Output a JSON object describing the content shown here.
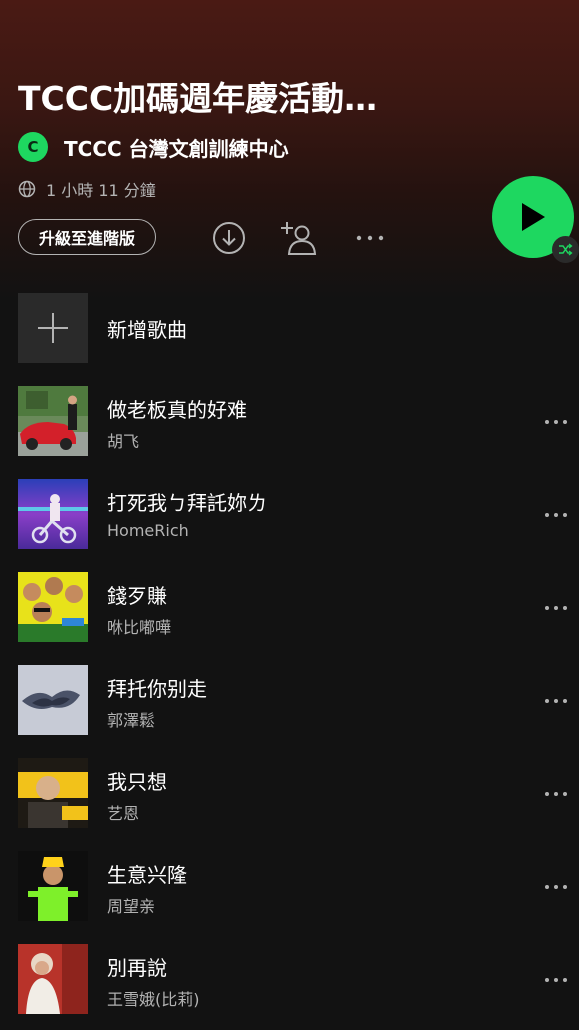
{
  "playlist": {
    "title": "TCCC加碼週年慶活動…",
    "owner_initial": "C",
    "owner_name": "TCCC 台灣文創訓練中心",
    "duration": "1 小時 11 分鐘",
    "upgrade_label": "升級至進階版"
  },
  "add_song_label": "新增歌曲",
  "tracks": [
    {
      "title": "做老板真的好难",
      "artist": "胡飞"
    },
    {
      "title": "打死我ㄅ拜託妳ㄌ",
      "artist": "HomeRich"
    },
    {
      "title": "錢歹賺",
      "artist": "咻比嘟嘩"
    },
    {
      "title": "拜托你别走",
      "artist": "郭澤鬆"
    },
    {
      "title": "我只想",
      "artist": "艺恩"
    },
    {
      "title": "生意兴隆",
      "artist": "周望亲"
    },
    {
      "title": "別再說",
      "artist": "王雪娥(比莉)"
    }
  ],
  "colors": {
    "accent": "#1ed760",
    "header": "#4a1a14",
    "background": "#121212",
    "secondary_text": "#b3b3b3"
  }
}
